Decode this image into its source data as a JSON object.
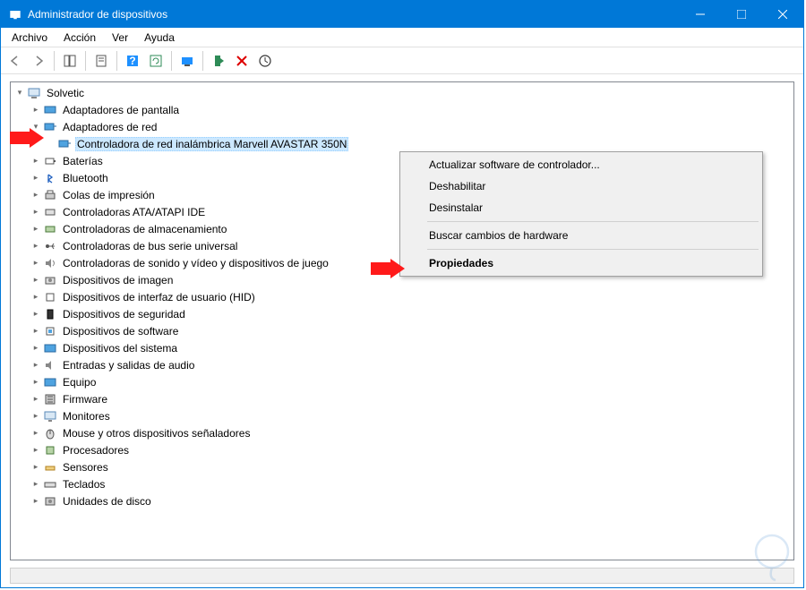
{
  "titlebar": {
    "title": "Administrador de dispositivos"
  },
  "menu": {
    "archivo": "Archivo",
    "accion": "Acción",
    "ver": "Ver",
    "ayuda": "Ayuda"
  },
  "tree": {
    "root": "Solvetic",
    "items": [
      "Adaptadores de pantalla",
      "Adaptadores de red",
      "Baterías",
      "Bluetooth",
      "Colas de impresión",
      "Controladoras ATA/ATAPI IDE",
      "Controladoras de almacenamiento",
      "Controladoras de bus serie universal",
      "Controladoras de sonido y vídeo y dispositivos de juego",
      "Dispositivos de imagen",
      "Dispositivos de interfaz de usuario (HID)",
      "Dispositivos de seguridad",
      "Dispositivos de software",
      "Dispositivos del sistema",
      "Entradas y salidas de audio",
      "Equipo",
      "Firmware",
      "Monitores",
      "Mouse y otros dispositivos señaladores",
      "Procesadores",
      "Sensores",
      "Teclados",
      "Unidades de disco"
    ],
    "selected_child": "Controladora de red inalámbrica Marvell AVASTAR 350N"
  },
  "context": {
    "update": "Actualizar software de controlador...",
    "disable": "Deshabilitar",
    "uninstall": "Desinstalar",
    "scan": "Buscar cambios de hardware",
    "properties": "Propiedades"
  }
}
